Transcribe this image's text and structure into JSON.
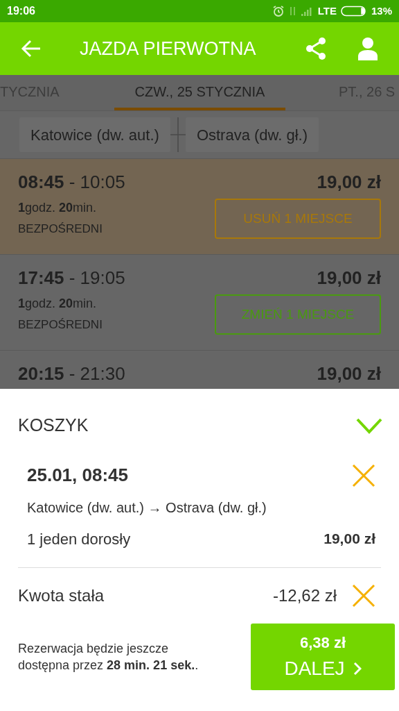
{
  "status_bar": {
    "time": "19:06",
    "network": "LTE",
    "battery": "13%"
  },
  "app_bar": {
    "title": "JAZDA PIERWOTNA"
  },
  "date_tabs": [
    {
      "label": "TYCZNIA",
      "selected": false
    },
    {
      "label": "CZW., 25 STYCZNIA",
      "selected": true
    },
    {
      "label": "PT., 26 S",
      "selected": false
    }
  ],
  "route": {
    "from": "Katowice (dw. aut.)",
    "to": "Ostrava (dw. gł.)"
  },
  "trips": [
    {
      "times": "**08:45** - 10:05",
      "price": "19,00 zł",
      "duration": "**1**godz. **20**min.",
      "type": "BEZPOŚREDNI",
      "action": {
        "kind": "remove",
        "label": "USUŃ 1 MIEJSCE"
      },
      "selected": true
    },
    {
      "times": "**17:45** - 19:05",
      "price": "19,00 zł",
      "duration": "**1**godz. **20**min.",
      "type": "BEZPOŚREDNI",
      "action": {
        "kind": "change",
        "label": "ZMIEŃ 1 MIEJSCE"
      },
      "selected": false
    },
    {
      "times": "**20:15** - 21:30",
      "price": "19,00 zł",
      "selected": false
    }
  ],
  "cart": {
    "title": "KOSZYK",
    "expanded": true,
    "items": [
      {
        "when": "25.01, 08:45",
        "route": "Katowice (dw. aut.) → Ostrava (dw. gł.)",
        "passengers": "1 jeden dorosły",
        "price": "19,00 zł"
      }
    ],
    "fee": {
      "label": "Kwota stała",
      "amount": "-12,62 zł"
    },
    "notice": "Rezerwacja będzie jeszcze dostępna przez **28 min. 21 sek.**.",
    "total": "6,38 zł",
    "next": "DALEJ"
  }
}
